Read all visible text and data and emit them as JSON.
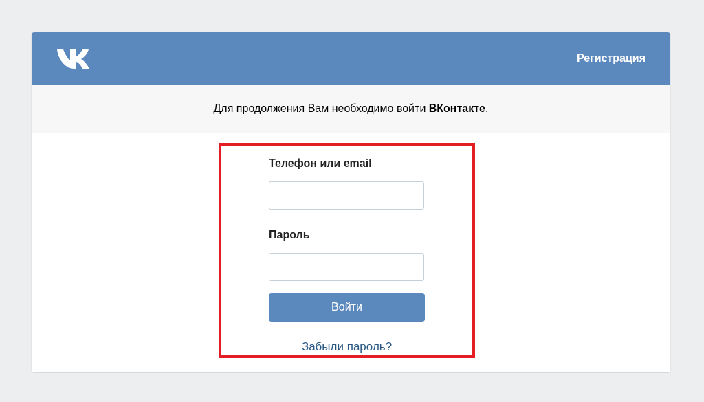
{
  "header": {
    "register_link": "Регистрация"
  },
  "notice": "Для продолжения Вам необходимо войти **ВКонтакте**.",
  "form": {
    "fields": [
      {
        "label": "Телефон или email"
      },
      {
        "label": "Пароль"
      }
    ],
    "submit": "Войти",
    "forgot_link": "Забыли пароль?"
  }
}
